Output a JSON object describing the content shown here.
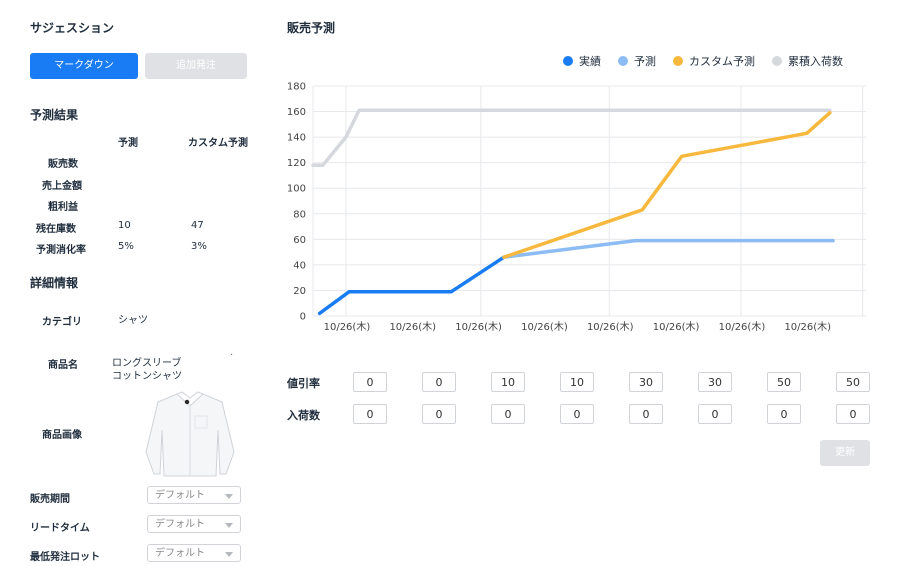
{
  "sidebar": {
    "title": "サジェスション",
    "markdown_button": "マークダウン",
    "reorder_button": "追加発注",
    "forecast_title": "予測結果",
    "col_forecast": "予測",
    "col_custom": "カスタム予測",
    "rows": [
      {
        "label": "販売数",
        "forecast": "",
        "custom": ""
      },
      {
        "label": "売上金額",
        "forecast": "",
        "custom": ""
      },
      {
        "label": "粗利益",
        "forecast": "",
        "custom": ""
      },
      {
        "label": "残在庫数",
        "forecast": "10",
        "custom": "47"
      },
      {
        "label": "予測消化率",
        "forecast": "5%",
        "custom": "3%"
      }
    ],
    "detail_title": "詳細情報",
    "category_label": "カテゴリ",
    "category_value": "シャツ",
    "product_label": "商品名",
    "product_value_line1": "ロングスリーブ",
    "product_value_line2": "コットンシャツ",
    "product_dot": "·",
    "image_label": "商品画像",
    "settings": [
      {
        "label": "販売期間",
        "value": "デフォルト"
      },
      {
        "label": "リードタイム",
        "value": "デフォルト"
      },
      {
        "label": "最低発注ロット",
        "value": "デフォルト"
      }
    ]
  },
  "main": {
    "title": "販売予測",
    "discount_label": "値引率",
    "inbound_label": "入荷数",
    "discount_values": [
      "0",
      "0",
      "10",
      "10",
      "30",
      "30",
      "50",
      "50"
    ],
    "inbound_values": [
      "0",
      "0",
      "0",
      "0",
      "0",
      "0",
      "0",
      "0"
    ],
    "update_button": "更新"
  },
  "colors": {
    "actual": "#1a7cf4",
    "forecast": "#8dbcf5",
    "custom": "#f7b83d",
    "cumulative": "#d5d8dc"
  },
  "chart_data": {
    "type": "line",
    "legend": [
      "実績",
      "予測",
      "カスタム予測",
      "累積入荷数"
    ],
    "x_ticks": [
      "10/26(木)",
      "10/26(木)",
      "10/26(木)",
      "10/26(木)",
      "10/26(木)",
      "10/26(木)",
      "10/26(木)",
      "10/26(木)"
    ],
    "y_ticks": [
      0,
      20,
      40,
      60,
      80,
      100,
      120,
      140,
      160,
      180
    ],
    "ylim": [
      0,
      180
    ],
    "xlim": [
      0,
      8.4
    ],
    "grid": true,
    "legend_position": "top-right",
    "series": [
      {
        "name": "累積入荷数",
        "color_key": "cumulative",
        "points": [
          [
            0,
            118
          ],
          [
            0.15,
            118
          ],
          [
            0.5,
            140
          ],
          [
            0.7,
            161
          ],
          [
            7.85,
            161
          ]
        ]
      },
      {
        "name": "実績",
        "color_key": "actual",
        "points": [
          [
            0.1,
            2
          ],
          [
            0.55,
            19
          ],
          [
            2.1,
            19
          ],
          [
            2.9,
            46
          ]
        ]
      },
      {
        "name": "予測",
        "color_key": "forecast",
        "points": [
          [
            2.9,
            46
          ],
          [
            4.9,
            59
          ],
          [
            7.9,
            59
          ]
        ]
      },
      {
        "name": "カスタム予測",
        "color_key": "custom",
        "points": [
          [
            2.9,
            46
          ],
          [
            5.0,
            83
          ],
          [
            5.6,
            125
          ],
          [
            7.5,
            143
          ],
          [
            7.85,
            159
          ]
        ]
      }
    ]
  }
}
